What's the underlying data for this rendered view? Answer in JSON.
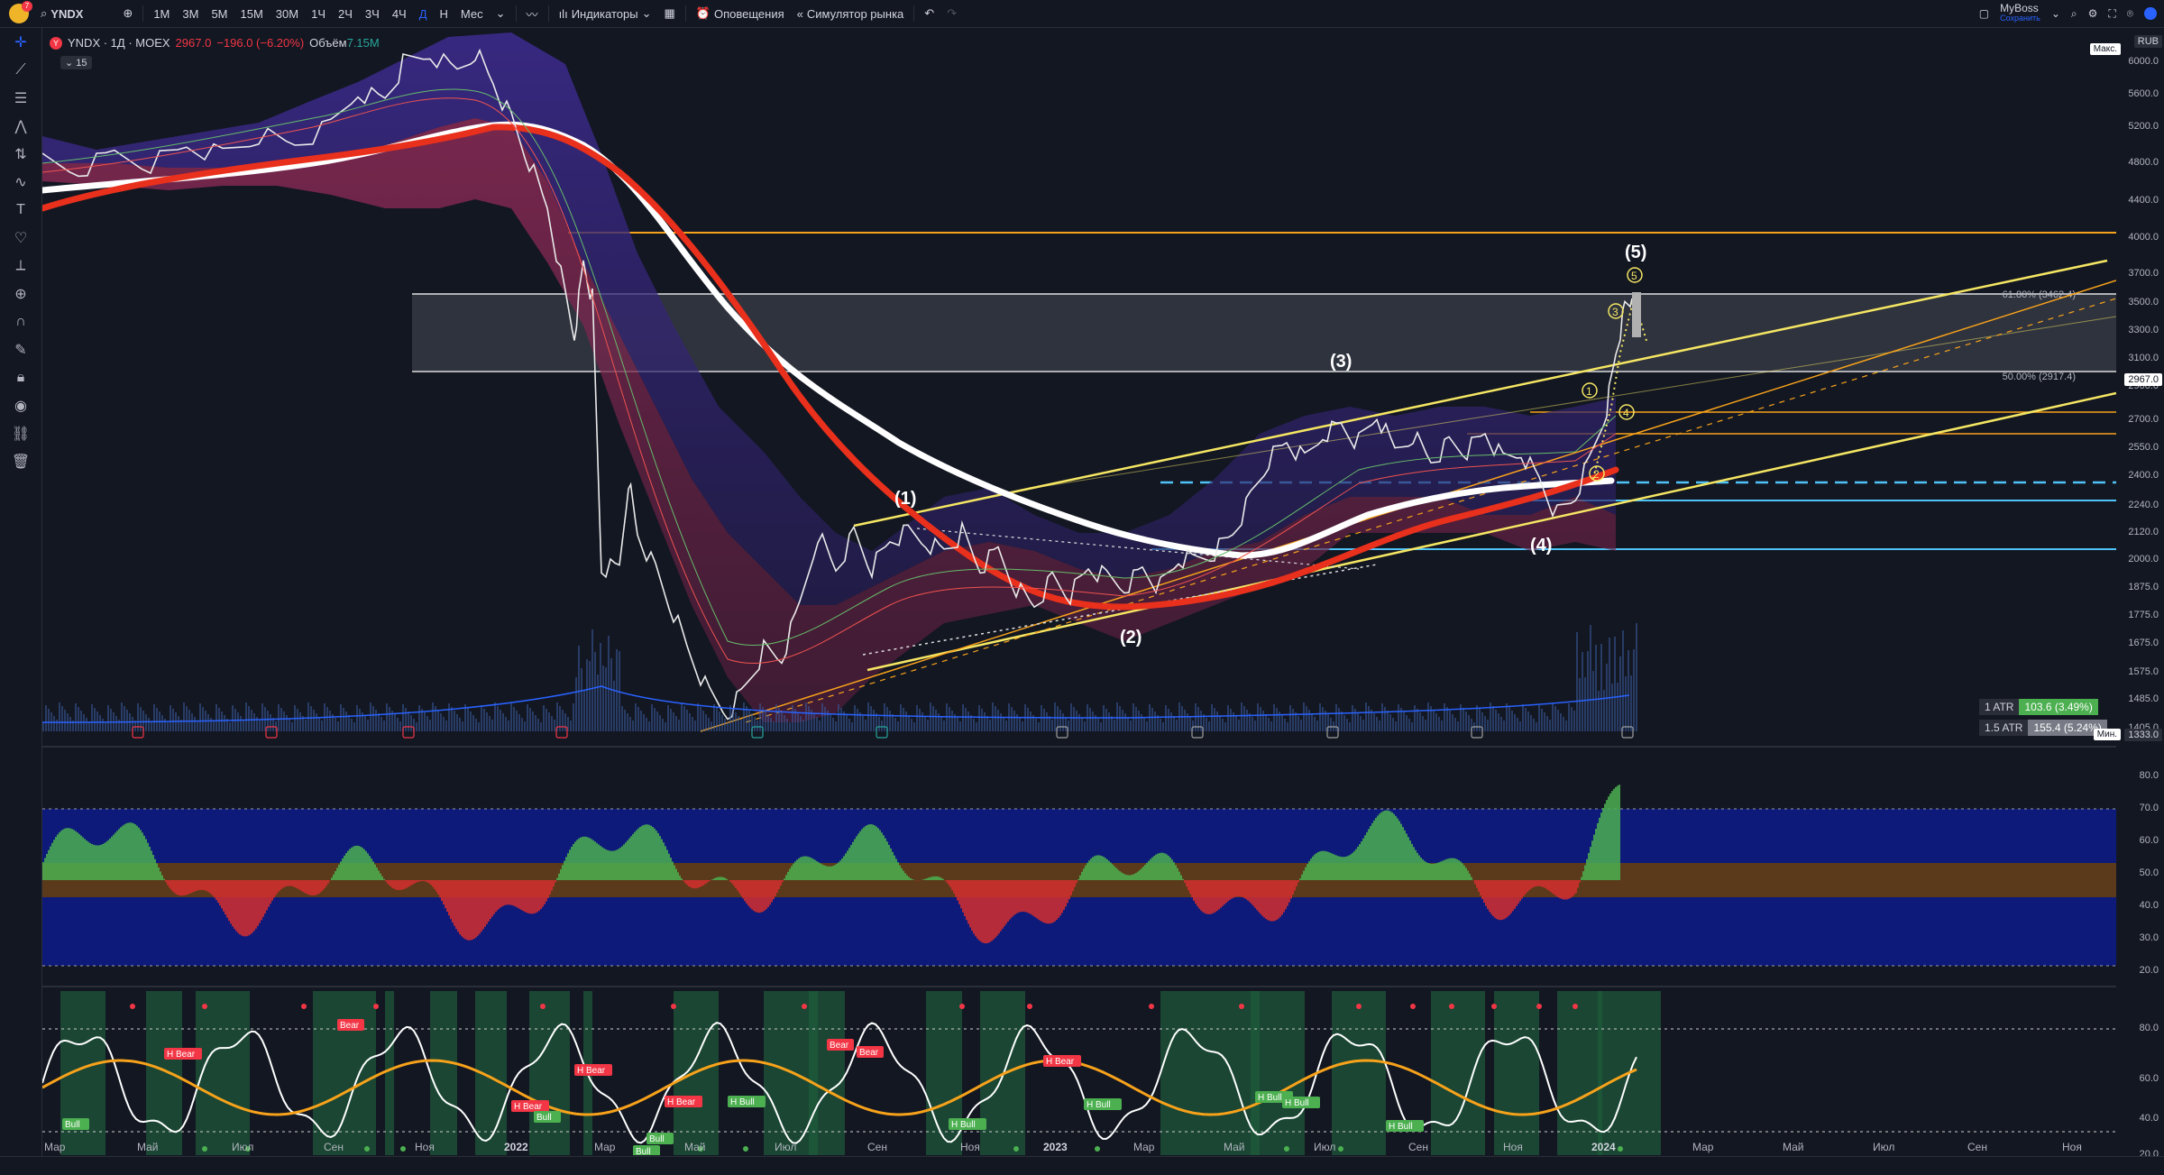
{
  "toolbar": {
    "symbol": "YNDX",
    "intervals": [
      "1М",
      "3М",
      "5М",
      "15М",
      "30М",
      "1Ч",
      "2Ч",
      "3Ч",
      "4Ч",
      "Д",
      "Н",
      "Мес"
    ],
    "active_interval": "Д",
    "indicators_label": "Индикаторы",
    "alerts_label": "Оповещения",
    "replay_label": "Симулятор рынка",
    "account_name": "MyBoss",
    "account_status": "Сохранить",
    "notification_count": "7"
  },
  "legend": {
    "title": "YNDX · 1Д · MOEX",
    "price": "2967.0",
    "change": "−196.0 (−6.20%)",
    "volume_label": "Объём",
    "volume": "7.15M",
    "badge": "15"
  },
  "yaxis": {
    "currency": "RUB",
    "max_label": "Макс.",
    "min_label": "Мин.",
    "min_value": "1333.0",
    "current_price": "2967.0",
    "ticks": [
      "6000.0",
      "5600.0",
      "5200.0",
      "4800.0",
      "4400.0",
      "4000.0",
      "3700.0",
      "3500.0",
      "3300.0",
      "3100.0",
      "2900.0",
      "2700.0",
      "2550.0",
      "2400.0",
      "2240.0",
      "2120.0",
      "2000.0",
      "1875.0",
      "1775.0",
      "1675.0",
      "1575.0",
      "1485.0",
      "1405.0"
    ],
    "rsi_ticks": [
      "80.0",
      "70.0",
      "60.0",
      "50.0",
      "40.0",
      "30.0",
      "20.0"
    ],
    "osc_ticks": [
      "80.0",
      "60.0",
      "40.0",
      "20.0"
    ]
  },
  "xaxis": {
    "ticks": [
      "Мар",
      "Май",
      "Июл",
      "Сен",
      "Ноя",
      "2022",
      "Мар",
      "Май",
      "Июл",
      "Сен",
      "Ноя",
      "2023",
      "Мар",
      "Май",
      "Июл",
      "Сен",
      "Ноя",
      "2024",
      "Мар",
      "Май",
      "Июл",
      "Сен",
      "Ноя"
    ]
  },
  "fib": {
    "level_618": "61.80% (3462.4)",
    "level_50": "50.00% (2917.4)"
  },
  "waves": {
    "w1": "(1)",
    "w2": "(2)",
    "w3": "(3)",
    "w4": "(4)",
    "w5": "(5)",
    "sub": [
      "1",
      "2",
      "3",
      "4",
      "5"
    ]
  },
  "atr": {
    "atr1_label": "1 ATR",
    "atr1_value": "103.6 (3.49%)",
    "atr15_label": "1.5 ATR",
    "atr15_value": "155.4 (5.24%)"
  },
  "osc_labels": {
    "bear": "Bear",
    "h_bear": "H Bear",
    "bull": "Bull",
    "h_bull": "H Bull"
  },
  "colors": {
    "background": "#131722",
    "ema_white": "#ffffff",
    "ema_red": "#e8301c",
    "channel_yellow": "#f5e663",
    "orange_line": "#f7a21b",
    "cyan_line": "#4fc3f7",
    "rsi_up": "#4caf50",
    "rsi_down": "#d32f2f",
    "rsi_band": "#0d1a7a",
    "rsi_mid": "#5a3a1a"
  }
}
